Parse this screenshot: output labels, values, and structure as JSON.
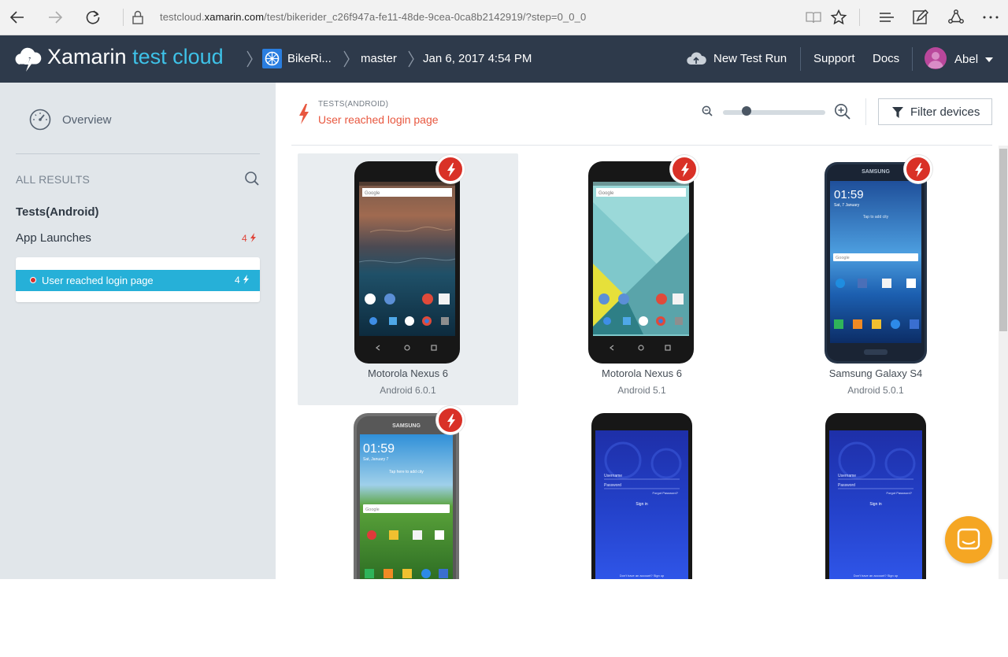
{
  "browser": {
    "url_prefix": "testcloud.",
    "url_domain": "xamarin.com",
    "url_path": "/test/bikerider_c26f947a-fe11-48de-9cea-0ca8b2142919/?step=0_0_0"
  },
  "header": {
    "brand_bold": "Xamarin",
    "brand_light": "test cloud",
    "crumbs": [
      "BikeRi...",
      "master",
      "Jan 6, 2017 4:54 PM"
    ],
    "new_test_run": "New Test Run",
    "support": "Support",
    "docs": "Docs",
    "user": "Abel"
  },
  "sidebar": {
    "overview": "Overview",
    "all_results": "ALL RESULTS",
    "tests_heading": "Tests(Android)",
    "app_launches": "App Launches",
    "app_launches_count": "4",
    "step_label": "User reached login page",
    "step_count": "4"
  },
  "main": {
    "tests_label": "TESTS(ANDROID)",
    "step_title": "User reached login page",
    "filter_label": "Filter devices",
    "zoom_level": 0.2
  },
  "devices": [
    {
      "name": "Motorola Nexus 6",
      "os": "Android 6.0.1",
      "failed": true,
      "selected": true
    },
    {
      "name": "Motorola Nexus 6",
      "os": "Android 5.1",
      "failed": true,
      "selected": false
    },
    {
      "name": "Samsung Galaxy S4",
      "os": "Android 5.0.1",
      "failed": true,
      "selected": false
    },
    {
      "name": "",
      "os": "",
      "failed": true,
      "selected": false
    },
    {
      "name": "",
      "os": "",
      "failed": false,
      "selected": false
    },
    {
      "name": "",
      "os": "",
      "failed": false,
      "selected": false
    }
  ],
  "screens": {
    "samsung_brand": "SAMSUNG",
    "s4_time": "01:59",
    "s4_date": "Sat, 7 January",
    "s4_hint": "Tap to add city",
    "s5_time": "01:59",
    "s5_date": "Sat, January 7",
    "s5_hint": "Tap here to add city",
    "google": "Google",
    "login_username": "Username",
    "login_password": "Password",
    "login_forgot": "Forgot Password?",
    "login_signin": "Sign in",
    "login_signup": "Don't have an account? Sign up"
  },
  "colors": {
    "header_bg": "#2e3a4b",
    "accent_blue": "#26b0d8",
    "fail_red": "#d93127",
    "step_orange": "#e8573f",
    "chat_orange": "#f5a623"
  }
}
